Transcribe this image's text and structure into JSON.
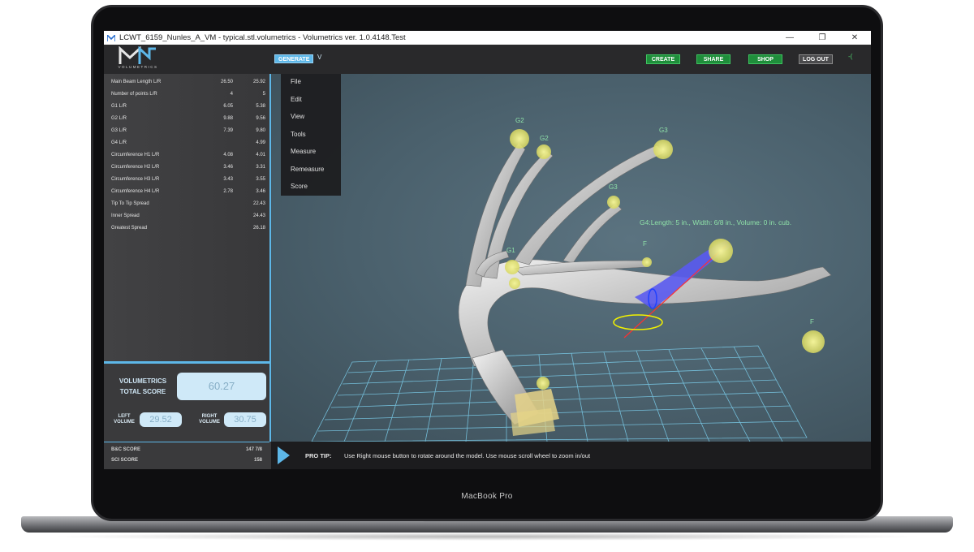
{
  "device": {
    "brand_label": "MacBook Pro"
  },
  "window": {
    "title": "LCWT_6159_Nunles_A_VM - typical.stl.volumetrics - Volumetrics ver. 1.0.4148.Test",
    "app_icon": "volumetrics-logo-icon",
    "controls": {
      "minimize": "—",
      "restore": "❐",
      "close": "✕"
    }
  },
  "toolbar": {
    "logo_text": "VOLUMETRICS",
    "generate_label": "GENERATE",
    "generate_caret": "V",
    "create_label": "CREATE",
    "share_label": "SHARE",
    "shop_label": "SHOP",
    "logout_label": "LOG OUT",
    "trailing_mark": "-(",
    "accent_color": "#5db7e8",
    "button_color": "#1f8e3b"
  },
  "menu": {
    "items": [
      "File",
      "Edit",
      "View",
      "Tools",
      "Measure",
      "Remeasure",
      "Score"
    ]
  },
  "measurements": [
    {
      "label": "Main Beam Length L/R",
      "left": "26.50",
      "right": "25.92"
    },
    {
      "label": "Number of points L/R",
      "left": "4",
      "right": "5"
    },
    {
      "label": "G1 L/R",
      "left": "6.05",
      "right": "5.38"
    },
    {
      "label": "G2 L/R",
      "left": "9.88",
      "right": "9.56"
    },
    {
      "label": "G3 L/R",
      "left": "7.39",
      "right": "9.80"
    },
    {
      "label": "G4 L/R",
      "left": "",
      "right": "4.99"
    },
    {
      "label": "Circumference H1 L/R",
      "left": "4.08",
      "right": "4.01"
    },
    {
      "label": "Circumference H2 L/R",
      "left": "3.46",
      "right": "3.31"
    },
    {
      "label": "Circumference H3 L/R",
      "left": "3.43",
      "right": "3.55"
    },
    {
      "label": "Circumference H4 L/R",
      "left": "2.78",
      "right": "3.46"
    }
  ],
  "spreads": [
    {
      "label": "Tip To Tip Spread",
      "value": "22.43"
    },
    {
      "label": "Inner Spread",
      "value": "24.43"
    },
    {
      "label": "Greatest Spread",
      "value": "26.18"
    }
  ],
  "score": {
    "title_line1": "VOLUMETRICS",
    "title_line2": "TOTAL SCORE",
    "total": "60.27",
    "left_label_line1": "LEFT",
    "left_label_line2": "VOLUME",
    "left_value": "29.52",
    "right_label_line1": "RIGHT",
    "right_label_line2": "VOLUME",
    "right_value": "30.75"
  },
  "other_scores": [
    {
      "label": "B&C SCORE",
      "value": "147 7/8"
    },
    {
      "label": "SCI SCORE",
      "value": "158"
    }
  ],
  "viewport": {
    "measure_label": "G4:Length: 5 in., Width: 6/8 in., Volume: 0 in. cub.",
    "point_labels": {
      "g2a": "G2",
      "g2b": "G2",
      "g3a": "G3",
      "g3b": "G3",
      "g1": "G1",
      "f1": "F",
      "f2": "F"
    },
    "marker_color": "#e8e86a",
    "highlight_color": "#5a5af0"
  },
  "tip": {
    "label": "PRO TIP:",
    "text": "Use Right mouse button to rotate around the model. Use mouse scroll wheel to zoom in/out"
  }
}
